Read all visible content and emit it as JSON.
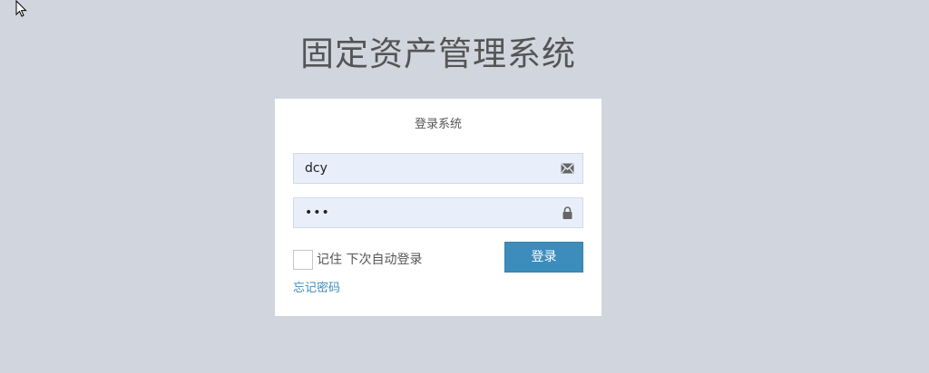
{
  "title": "固定资产管理系统",
  "login_panel": {
    "heading": "登录系统",
    "username": {
      "value": "dcy",
      "icon": "envelope-icon"
    },
    "password": {
      "masked_value": "•••",
      "icon": "lock-icon"
    },
    "remember": {
      "label": "记住 下次自动登录",
      "checked": false
    },
    "login_button": "登录",
    "forgot_password": "忘记密码"
  },
  "colors": {
    "background": "#d1d5de",
    "panel": "#ffffff",
    "input_background": "#e8effb",
    "button": "#3c8dbc",
    "link": "#3c8dbc"
  }
}
